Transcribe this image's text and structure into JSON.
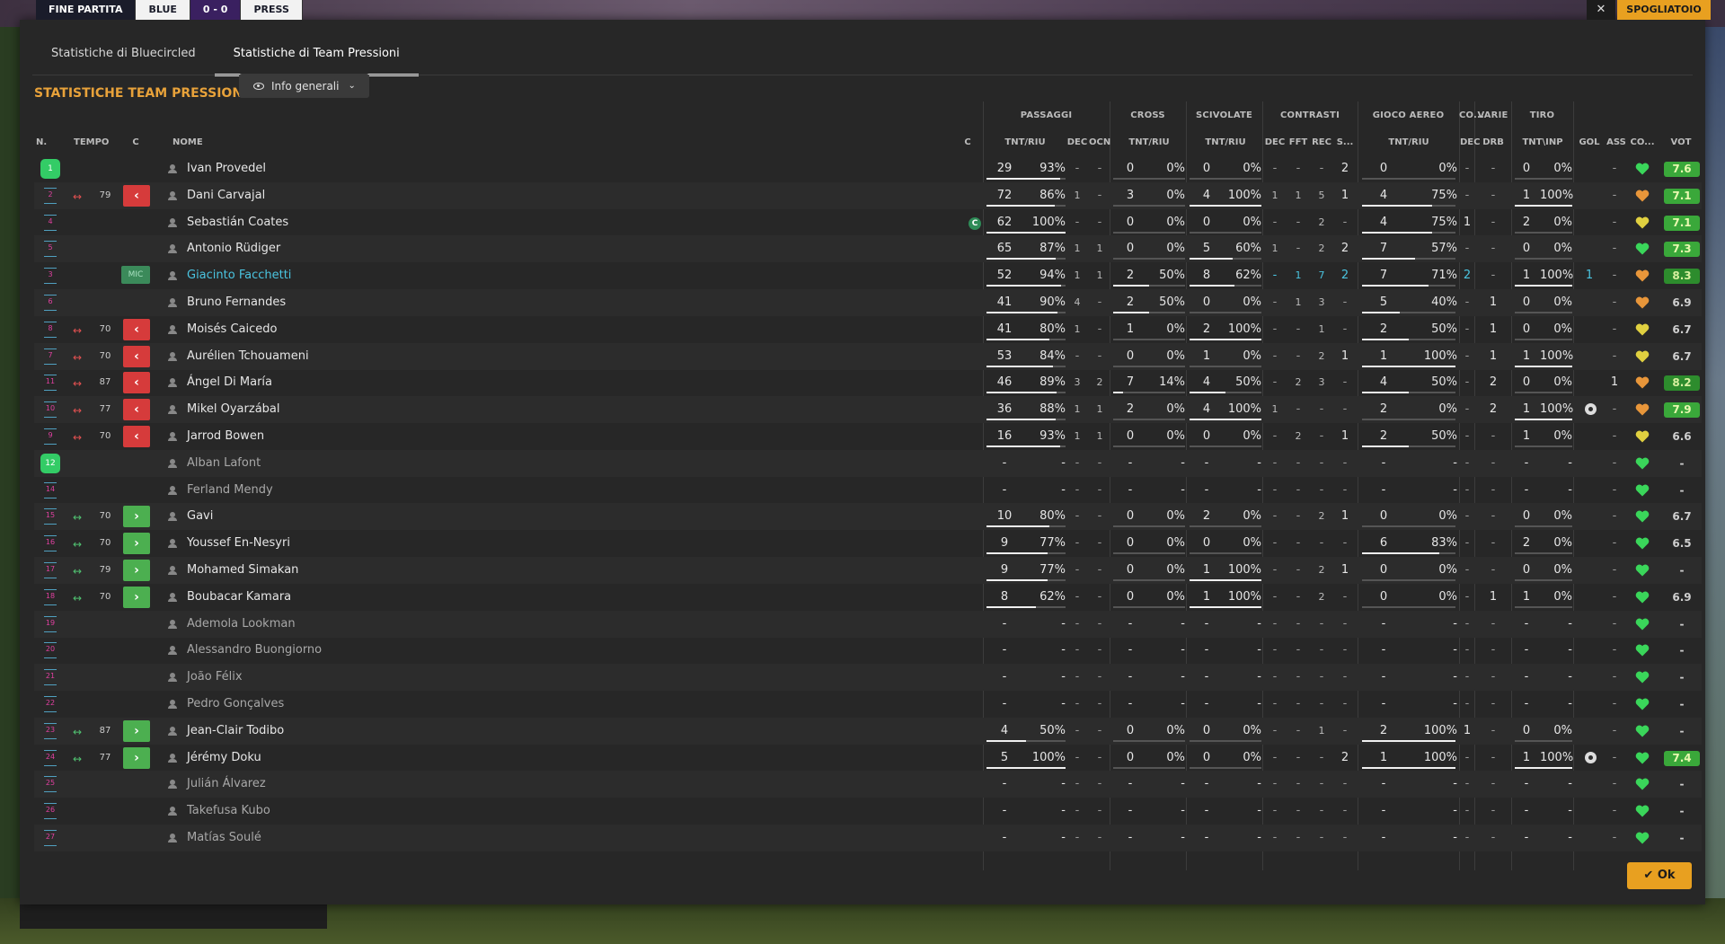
{
  "background_bar": {
    "items": [
      "FINE PARTITA",
      "BLUE",
      "0 - 0",
      "PRESS"
    ],
    "close": "✕",
    "right_button": "SPOGLIATOIO"
  },
  "tabs": [
    "Statistiche di Bluecircled",
    "Statistiche di Team Pressioni"
  ],
  "active_tab": 1,
  "section_title": "STATISTICHE TEAM PRESSIONI",
  "view_dropdown": "Info generali",
  "group_headers": {
    "passaggi": "PASSAGGI",
    "cross": "CROSS",
    "scivolate": "SCIVOLATE",
    "contrasti": "CONTRASTI",
    "gioco_aereo": "GIOCO AEREO",
    "co": "CO...",
    "varie": "VARIE",
    "tiro": "TIRO"
  },
  "columns": {
    "n": "N.",
    "tempo": "TEMPO",
    "c": "C",
    "nome": "NOME",
    "c2": "C",
    "pass_tnt": "TNT/RIU",
    "pass_dec": "DEC",
    "pass_ocn": "OCN",
    "cross_tnt": "TNT/RIU",
    "sciv_tnt": "TNT/RIU",
    "con_dec": "DEC",
    "con_fft": "FFT",
    "con_rec": "REC",
    "con_s": "S...",
    "aer_tnt": "TNT/RIU",
    "co_dec": "DEC",
    "var_drb": "DRB",
    "tiro": "TNT\\INP",
    "gol": "GOL",
    "ass": "ASS",
    "co2": "CO...",
    "vot": "VOT"
  },
  "players": [
    {
      "n": "1",
      "gk": true,
      "time": "",
      "swap": "",
      "sub": "",
      "role": "",
      "name": "Ivan Provedel",
      "cap": false,
      "p": [
        "29",
        "93%"
      ],
      "pd": "-",
      "po": "-",
      "cr": [
        "0",
        "0%"
      ],
      "sc": [
        "0",
        "0%"
      ],
      "cd": "-",
      "cf": "-",
      "crc": "-",
      "cs": "2",
      "ae": [
        "0",
        "0%"
      ],
      "cod": "-",
      "drb": "-",
      "ti": [
        "0",
        "0%"
      ],
      "gear": false,
      "gol": "",
      "ass": "-",
      "heart": "green",
      "vot": "7.6",
      "vc": "g1"
    },
    {
      "n": "2",
      "gk": false,
      "time": "79",
      "swap": "out",
      "sub": "out",
      "role": "",
      "name": "Dani Carvajal",
      "cap": false,
      "p": [
        "72",
        "86%"
      ],
      "pd": "1",
      "po": "-",
      "cr": [
        "3",
        "0%"
      ],
      "sc": [
        "4",
        "100%"
      ],
      "cd": "1",
      "cf": "1",
      "crc": "5",
      "cs": "1",
      "ae": [
        "4",
        "75%"
      ],
      "cod": "-",
      "drb": "-",
      "ti": [
        "1",
        "100%"
      ],
      "gear": false,
      "gol": "",
      "ass": "-",
      "heart": "orange",
      "vot": "7.1",
      "vc": "g1"
    },
    {
      "n": "4",
      "gk": false,
      "time": "",
      "swap": "",
      "sub": "",
      "role": "",
      "name": "Sebastián Coates",
      "cap": true,
      "p": [
        "62",
        "100%"
      ],
      "pd": "-",
      "po": "-",
      "cr": [
        "0",
        "0%"
      ],
      "sc": [
        "0",
        "0%"
      ],
      "cd": "-",
      "cf": "-",
      "crc": "2",
      "cs": "-",
      "ae": [
        "4",
        "75%"
      ],
      "cod": "1",
      "drb": "-",
      "ti": [
        "2",
        "0%"
      ],
      "gear": false,
      "gol": "",
      "ass": "-",
      "heart": "yellow",
      "vot": "7.1",
      "vc": "g1"
    },
    {
      "n": "5",
      "gk": false,
      "time": "",
      "swap": "",
      "sub": "",
      "role": "",
      "name": "Antonio Rüdiger",
      "cap": false,
      "p": [
        "65",
        "87%"
      ],
      "pd": "1",
      "po": "1",
      "cr": [
        "0",
        "0%"
      ],
      "sc": [
        "5",
        "60%"
      ],
      "cd": "1",
      "cf": "-",
      "crc": "2",
      "cs": "2",
      "ae": [
        "7",
        "57%"
      ],
      "cod": "-",
      "drb": "-",
      "ti": [
        "0",
        "0%"
      ],
      "gear": false,
      "gol": "",
      "ass": "-",
      "heart": "green",
      "vot": "7.3",
      "vc": "g1"
    },
    {
      "n": "3",
      "gk": false,
      "time": "",
      "swap": "",
      "sub": "",
      "role": "MIC",
      "name": "Giacinto Facchetti",
      "hl": true,
      "cap": false,
      "p": [
        "52",
        "94%"
      ],
      "pd": "1",
      "po": "1",
      "cr": [
        "2",
        "50%"
      ],
      "sc": [
        "8",
        "62%"
      ],
      "cd": "-",
      "cf": "1",
      "crc": "7",
      "cs": "2",
      "ae": [
        "7",
        "71%"
      ],
      "cod": "2",
      "drb": "-",
      "ti": [
        "1",
        "100%"
      ],
      "gear": false,
      "gol": "1",
      "ass": "-",
      "heart": "orange",
      "vot": "8.3",
      "vc": "g2"
    },
    {
      "n": "6",
      "gk": false,
      "time": "",
      "swap": "",
      "sub": "",
      "role": "",
      "name": "Bruno Fernandes",
      "cap": false,
      "p": [
        "41",
        "90%"
      ],
      "pd": "4",
      "po": "-",
      "cr": [
        "2",
        "50%"
      ],
      "sc": [
        "0",
        "0%"
      ],
      "cd": "-",
      "cf": "1",
      "crc": "3",
      "cs": "-",
      "ae": [
        "5",
        "40%"
      ],
      "cod": "-",
      "drb": "1",
      "ti": [
        "0",
        "0%"
      ],
      "gear": false,
      "gol": "",
      "ass": "-",
      "heart": "orange",
      "vot": "6.9",
      "vc": "plain"
    },
    {
      "n": "8",
      "gk": false,
      "time": "70",
      "swap": "out",
      "sub": "out",
      "role": "",
      "name": "Moisés Caicedo",
      "cap": false,
      "p": [
        "41",
        "80%"
      ],
      "pd": "1",
      "po": "-",
      "cr": [
        "1",
        "0%"
      ],
      "sc": [
        "2",
        "100%"
      ],
      "cd": "-",
      "cf": "-",
      "crc": "1",
      "cs": "-",
      "ae": [
        "2",
        "50%"
      ],
      "cod": "-",
      "drb": "1",
      "ti": [
        "0",
        "0%"
      ],
      "gear": false,
      "gol": "",
      "ass": "-",
      "heart": "yellow",
      "vot": "6.7",
      "vc": "plain"
    },
    {
      "n": "7",
      "gk": false,
      "time": "70",
      "swap": "out",
      "sub": "out",
      "role": "",
      "name": "Aurélien Tchouameni",
      "cap": false,
      "p": [
        "53",
        "84%"
      ],
      "pd": "-",
      "po": "-",
      "cr": [
        "0",
        "0%"
      ],
      "sc": [
        "1",
        "0%"
      ],
      "cd": "-",
      "cf": "-",
      "crc": "2",
      "cs": "1",
      "ae": [
        "1",
        "100%"
      ],
      "cod": "-",
      "drb": "1",
      "ti": [
        "1",
        "100%"
      ],
      "gear": false,
      "gol": "",
      "ass": "-",
      "heart": "yellow",
      "vot": "6.7",
      "vc": "plain"
    },
    {
      "n": "11",
      "gk": false,
      "time": "87",
      "swap": "out",
      "sub": "out",
      "role": "",
      "name": "Ángel Di María",
      "cap": false,
      "p": [
        "46",
        "89%"
      ],
      "pd": "3",
      "po": "2",
      "cr": [
        "7",
        "14%"
      ],
      "sc": [
        "4",
        "50%"
      ],
      "cd": "-",
      "cf": "2",
      "crc": "3",
      "cs": "-",
      "ae": [
        "4",
        "50%"
      ],
      "cod": "-",
      "drb": "2",
      "ti": [
        "0",
        "0%"
      ],
      "gear": false,
      "gol": "",
      "ass": "1",
      "heart": "orange",
      "vot": "8.2",
      "vc": "g2"
    },
    {
      "n": "10",
      "gk": false,
      "time": "77",
      "swap": "out",
      "sub": "out",
      "role": "",
      "name": "Mikel Oyarzábal",
      "cap": false,
      "p": [
        "36",
        "88%"
      ],
      "pd": "1",
      "po": "1",
      "cr": [
        "2",
        "0%"
      ],
      "sc": [
        "4",
        "100%"
      ],
      "cd": "1",
      "cf": "-",
      "crc": "-",
      "cs": "-",
      "ae": [
        "2",
        "0%"
      ],
      "cod": "-",
      "drb": "2",
      "ti": [
        "1",
        "100%"
      ],
      "gear": true,
      "gol": "",
      "ass": "-",
      "heart": "orange",
      "vot": "7.9",
      "vc": "g1"
    },
    {
      "n": "9",
      "gk": false,
      "time": "70",
      "swap": "out",
      "sub": "out",
      "role": "",
      "name": "Jarrod Bowen",
      "cap": false,
      "p": [
        "16",
        "93%"
      ],
      "pd": "1",
      "po": "1",
      "cr": [
        "0",
        "0%"
      ],
      "sc": [
        "0",
        "0%"
      ],
      "cd": "-",
      "cf": "2",
      "crc": "-",
      "cs": "1",
      "ae": [
        "2",
        "50%"
      ],
      "cod": "-",
      "drb": "-",
      "ti": [
        "1",
        "0%"
      ],
      "gear": false,
      "gol": "",
      "ass": "-",
      "heart": "yellow",
      "vot": "6.6",
      "vc": "plain"
    },
    {
      "n": "12",
      "gk": true,
      "time": "",
      "swap": "",
      "sub": "",
      "role": "",
      "name": "Alban Lafont",
      "dim": true,
      "cap": false,
      "p": [
        "-",
        "-"
      ],
      "pd": "-",
      "po": "-",
      "cr": [
        "-",
        "-"
      ],
      "sc": [
        "-",
        "-"
      ],
      "cd": "-",
      "cf": "-",
      "crc": "-",
      "cs": "-",
      "ae": [
        "-",
        "-"
      ],
      "cod": "-",
      "drb": "-",
      "ti": [
        "-",
        "-"
      ],
      "gear": false,
      "gol": "",
      "ass": "-",
      "heart": "green",
      "vot": "-",
      "vc": "plain"
    },
    {
      "n": "14",
      "gk": false,
      "time": "",
      "swap": "",
      "sub": "",
      "role": "",
      "name": "Ferland Mendy",
      "dim": true,
      "cap": false,
      "p": [
        "-",
        "-"
      ],
      "pd": "-",
      "po": "-",
      "cr": [
        "-",
        "-"
      ],
      "sc": [
        "-",
        "-"
      ],
      "cd": "-",
      "cf": "-",
      "crc": "-",
      "cs": "-",
      "ae": [
        "-",
        "-"
      ],
      "cod": "-",
      "drb": "-",
      "ti": [
        "-",
        "-"
      ],
      "gear": false,
      "gol": "",
      "ass": "-",
      "heart": "green",
      "vot": "-",
      "vc": "plain"
    },
    {
      "n": "15",
      "gk": false,
      "time": "70",
      "swap": "in",
      "sub": "in",
      "role": "",
      "name": "Gavi",
      "cap": false,
      "p": [
        "10",
        "80%"
      ],
      "pd": "-",
      "po": "-",
      "cr": [
        "0",
        "0%"
      ],
      "sc": [
        "2",
        "0%"
      ],
      "cd": "-",
      "cf": "-",
      "crc": "2",
      "cs": "1",
      "ae": [
        "0",
        "0%"
      ],
      "cod": "-",
      "drb": "-",
      "ti": [
        "0",
        "0%"
      ],
      "gear": false,
      "gol": "",
      "ass": "-",
      "heart": "green",
      "vot": "6.7",
      "vc": "plain"
    },
    {
      "n": "16",
      "gk": false,
      "time": "70",
      "swap": "in",
      "sub": "in",
      "role": "",
      "name": "Youssef En-Nesyri",
      "cap": false,
      "p": [
        "9",
        "77%"
      ],
      "pd": "-",
      "po": "-",
      "cr": [
        "0",
        "0%"
      ],
      "sc": [
        "0",
        "0%"
      ],
      "cd": "-",
      "cf": "-",
      "crc": "-",
      "cs": "-",
      "ae": [
        "6",
        "83%"
      ],
      "cod": "-",
      "drb": "-",
      "ti": [
        "2",
        "0%"
      ],
      "gear": false,
      "gol": "",
      "ass": "-",
      "heart": "green",
      "vot": "6.5",
      "vc": "plain"
    },
    {
      "n": "17",
      "gk": false,
      "time": "79",
      "swap": "in",
      "sub": "in",
      "role": "",
      "name": "Mohamed Simakan",
      "cap": false,
      "p": [
        "9",
        "77%"
      ],
      "pd": "-",
      "po": "-",
      "cr": [
        "0",
        "0%"
      ],
      "sc": [
        "1",
        "100%"
      ],
      "cd": "-",
      "cf": "-",
      "crc": "2",
      "cs": "1",
      "ae": [
        "0",
        "0%"
      ],
      "cod": "-",
      "drb": "-",
      "ti": [
        "0",
        "0%"
      ],
      "gear": false,
      "gol": "",
      "ass": "-",
      "heart": "green",
      "vot": "-",
      "vc": "plain"
    },
    {
      "n": "18",
      "gk": false,
      "time": "70",
      "swap": "in",
      "sub": "in",
      "role": "",
      "name": "Boubacar Kamara",
      "cap": false,
      "p": [
        "8",
        "62%"
      ],
      "pd": "-",
      "po": "-",
      "cr": [
        "0",
        "0%"
      ],
      "sc": [
        "1",
        "100%"
      ],
      "cd": "-",
      "cf": "-",
      "crc": "2",
      "cs": "-",
      "ae": [
        "0",
        "0%"
      ],
      "cod": "-",
      "drb": "1",
      "ti": [
        "1",
        "0%"
      ],
      "gear": false,
      "gol": "",
      "ass": "-",
      "heart": "green",
      "vot": "6.9",
      "vc": "plain"
    },
    {
      "n": "19",
      "gk": false,
      "time": "",
      "swap": "",
      "sub": "",
      "role": "",
      "name": "Ademola Lookman",
      "dim": true,
      "cap": false,
      "p": [
        "-",
        "-"
      ],
      "pd": "-",
      "po": "-",
      "cr": [
        "-",
        "-"
      ],
      "sc": [
        "-",
        "-"
      ],
      "cd": "-",
      "cf": "-",
      "crc": "-",
      "cs": "-",
      "ae": [
        "-",
        "-"
      ],
      "cod": "-",
      "drb": "-",
      "ti": [
        "-",
        "-"
      ],
      "gear": false,
      "gol": "",
      "ass": "-",
      "heart": "green",
      "vot": "-",
      "vc": "plain"
    },
    {
      "n": "20",
      "gk": false,
      "time": "",
      "swap": "",
      "sub": "",
      "role": "",
      "name": "Alessandro Buongiorno",
      "dim": true,
      "cap": false,
      "p": [
        "-",
        "-"
      ],
      "pd": "-",
      "po": "-",
      "cr": [
        "-",
        "-"
      ],
      "sc": [
        "-",
        "-"
      ],
      "cd": "-",
      "cf": "-",
      "crc": "-",
      "cs": "-",
      "ae": [
        "-",
        "-"
      ],
      "cod": "-",
      "drb": "-",
      "ti": [
        "-",
        "-"
      ],
      "gear": false,
      "gol": "",
      "ass": "-",
      "heart": "green",
      "vot": "-",
      "vc": "plain"
    },
    {
      "n": "21",
      "gk": false,
      "time": "",
      "swap": "",
      "sub": "",
      "role": "",
      "name": "João Félix",
      "dim": true,
      "cap": false,
      "p": [
        "-",
        "-"
      ],
      "pd": "-",
      "po": "-",
      "cr": [
        "-",
        "-"
      ],
      "sc": [
        "-",
        "-"
      ],
      "cd": "-",
      "cf": "-",
      "crc": "-",
      "cs": "-",
      "ae": [
        "-",
        "-"
      ],
      "cod": "-",
      "drb": "-",
      "ti": [
        "-",
        "-"
      ],
      "gear": false,
      "gol": "",
      "ass": "-",
      "heart": "green",
      "vot": "-",
      "vc": "plain"
    },
    {
      "n": "22",
      "gk": false,
      "time": "",
      "swap": "",
      "sub": "",
      "role": "",
      "name": "Pedro Gonçalves",
      "dim": true,
      "cap": false,
      "p": [
        "-",
        "-"
      ],
      "pd": "-",
      "po": "-",
      "cr": [
        "-",
        "-"
      ],
      "sc": [
        "-",
        "-"
      ],
      "cd": "-",
      "cf": "-",
      "crc": "-",
      "cs": "-",
      "ae": [
        "-",
        "-"
      ],
      "cod": "-",
      "drb": "-",
      "ti": [
        "-",
        "-"
      ],
      "gear": false,
      "gol": "",
      "ass": "-",
      "heart": "green",
      "vot": "-",
      "vc": "plain"
    },
    {
      "n": "23",
      "gk": false,
      "time": "87",
      "swap": "in",
      "sub": "in",
      "role": "",
      "name": "Jean-Clair Todibo",
      "cap": false,
      "p": [
        "4",
        "50%"
      ],
      "pd": "-",
      "po": "-",
      "cr": [
        "0",
        "0%"
      ],
      "sc": [
        "0",
        "0%"
      ],
      "cd": "-",
      "cf": "-",
      "crc": "1",
      "cs": "-",
      "ae": [
        "2",
        "100%"
      ],
      "cod": "1",
      "drb": "-",
      "ti": [
        "0",
        "0%"
      ],
      "gear": false,
      "gol": "",
      "ass": "-",
      "heart": "green",
      "vot": "-",
      "vc": "plain"
    },
    {
      "n": "24",
      "gk": false,
      "time": "77",
      "swap": "in",
      "sub": "in",
      "role": "",
      "name": "Jérémy Doku",
      "cap": false,
      "p": [
        "5",
        "100%"
      ],
      "pd": "-",
      "po": "-",
      "cr": [
        "0",
        "0%"
      ],
      "sc": [
        "0",
        "0%"
      ],
      "cd": "-",
      "cf": "-",
      "crc": "-",
      "cs": "2",
      "ae": [
        "1",
        "100%"
      ],
      "cod": "-",
      "drb": "-",
      "ti": [
        "1",
        "100%"
      ],
      "gear": true,
      "gol": "",
      "ass": "-",
      "heart": "green",
      "vot": "7.4",
      "vc": "g1"
    },
    {
      "n": "25",
      "gk": false,
      "time": "",
      "swap": "",
      "sub": "",
      "role": "",
      "name": "Julián Álvarez",
      "dim": true,
      "cap": false,
      "p": [
        "-",
        "-"
      ],
      "pd": "-",
      "po": "-",
      "cr": [
        "-",
        "-"
      ],
      "sc": [
        "-",
        "-"
      ],
      "cd": "-",
      "cf": "-",
      "crc": "-",
      "cs": "-",
      "ae": [
        "-",
        "-"
      ],
      "cod": "-",
      "drb": "-",
      "ti": [
        "-",
        "-"
      ],
      "gear": false,
      "gol": "",
      "ass": "-",
      "heart": "green",
      "vot": "-",
      "vc": "plain"
    },
    {
      "n": "26",
      "gk": false,
      "time": "",
      "swap": "",
      "sub": "",
      "role": "",
      "name": "Takefusa Kubo",
      "dim": true,
      "cap": false,
      "p": [
        "-",
        "-"
      ],
      "pd": "-",
      "po": "-",
      "cr": [
        "-",
        "-"
      ],
      "sc": [
        "-",
        "-"
      ],
      "cd": "-",
      "cf": "-",
      "crc": "-",
      "cs": "-",
      "ae": [
        "-",
        "-"
      ],
      "cod": "-",
      "drb": "-",
      "ti": [
        "-",
        "-"
      ],
      "gear": false,
      "gol": "",
      "ass": "-",
      "heart": "green",
      "vot": "-",
      "vc": "plain"
    },
    {
      "n": "27",
      "gk": false,
      "time": "",
      "swap": "",
      "sub": "",
      "role": "",
      "name": "Matías Soulé",
      "dim": true,
      "cap": false,
      "p": [
        "-",
        "-"
      ],
      "pd": "-",
      "po": "-",
      "cr": [
        "-",
        "-"
      ],
      "sc": [
        "-",
        "-"
      ],
      "cd": "-",
      "cf": "-",
      "crc": "-",
      "cs": "-",
      "ae": [
        "-",
        "-"
      ],
      "cod": "-",
      "drb": "-",
      "ti": [
        "-",
        "-"
      ],
      "gear": false,
      "gol": "",
      "ass": "-",
      "heart": "green",
      "vot": "-",
      "vc": "plain"
    }
  ],
  "colors": {
    "accent": "#e8a23a",
    "ok": "#e8a020",
    "heart_green": "#3ad65a",
    "heart_orange": "#e8963a",
    "heart_yellow": "#e0d040",
    "sub_out": "#d63b3b",
    "sub_in": "#4caf50"
  },
  "icons": {
    "swap_out": "↔",
    "swap_in": "↔",
    "sub_out": "‹",
    "sub_in": "›",
    "captain": "C",
    "ok_check": "✔"
  },
  "ok_label": "Ok"
}
